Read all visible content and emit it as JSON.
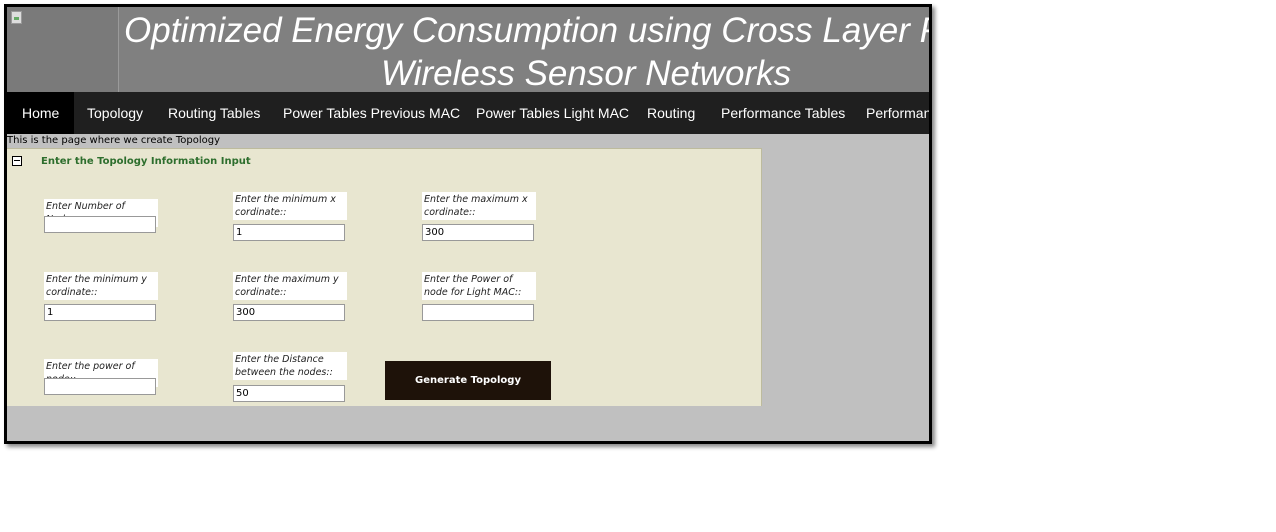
{
  "header": {
    "logo_icon": "broken-image-icon",
    "title_line1": "Optimized Energy Consumption using Cross Layer Functioning",
    "title_line2": "Wireless Sensor Networks"
  },
  "nav": {
    "items": [
      {
        "label": "Home"
      },
      {
        "label": "Topology"
      },
      {
        "label": "Routing Tables"
      },
      {
        "label": "Power Tables Previous MAC"
      },
      {
        "label": "Power Tables Light MAC"
      },
      {
        "label": "Routing"
      },
      {
        "label": "Performance Tables"
      },
      {
        "label": "Performance"
      }
    ],
    "active": "Home"
  },
  "status_text": "This is the page where we create Topology",
  "panel": {
    "collapse_icon": "minus-box-icon",
    "title": "Enter the Topology Information Input",
    "fields": {
      "num_nodes": {
        "label": "Enter Number of Nodes::",
        "value": ""
      },
      "min_x": {
        "label": "Enter the minimum x cordinate::",
        "value": "1"
      },
      "max_x": {
        "label": "Enter the maximum x cordinate::",
        "value": "300"
      },
      "min_y": {
        "label": "Enter the minimum y cordinate::",
        "value": "1"
      },
      "max_y": {
        "label": "Enter the maximum y cordinate::",
        "value": "300"
      },
      "power_light": {
        "label": "Enter the Power of node for Light MAC::",
        "value": ""
      },
      "power_node": {
        "label": "Enter the power of node::",
        "value": ""
      },
      "distance": {
        "label": "Enter the Distance between the nodes::",
        "value": "50"
      }
    },
    "generate_button": "Generate Topology"
  },
  "colors": {
    "header_bg": "#808080",
    "nav_bg": "#1f1f1f",
    "panel_bg": "#e8e6d0",
    "section_title": "#2d6e2d",
    "button_bg": "#1e1209"
  }
}
